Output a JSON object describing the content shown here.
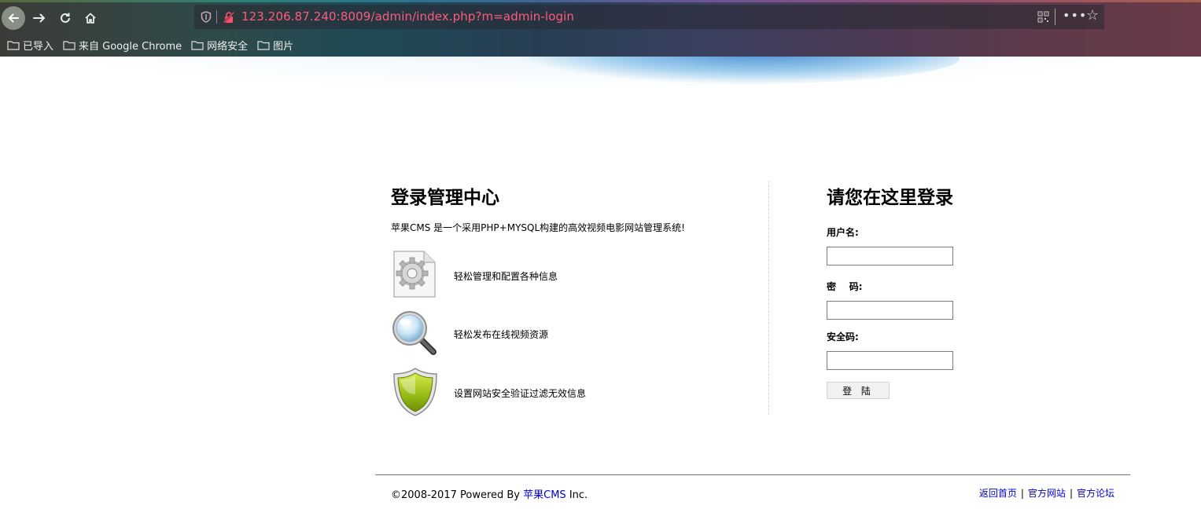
{
  "browser": {
    "url": "123.206.87.240:8009/admin/index.php?m=admin-login",
    "bookmarks": [
      "已导入",
      "来自 Google Chrome",
      "网络安全",
      "图片"
    ]
  },
  "left": {
    "title": "登录管理中心",
    "description": "苹果CMS 是一个采用PHP+MYSQL构建的高效视频电影网站管理系统!",
    "features": [
      {
        "icon": "gear-document-icon",
        "text": "轻松管理和配置各种信息"
      },
      {
        "icon": "magnifier-icon",
        "text": "轻松发布在线视频资源"
      },
      {
        "icon": "shield-icon",
        "text": "设置网站安全验证过滤无效信息"
      }
    ]
  },
  "login": {
    "title": "请您在这里登录",
    "username_label": "用户名:",
    "username_value": "",
    "password_label": "密    码:",
    "password_value": "",
    "captcha_label": "安全码:",
    "captcha_value": "",
    "submit_label": "登 陆"
  },
  "footer": {
    "copyright_prefix": "©2008-2017 Powered By ",
    "brand_link": "苹果CMS",
    "copyright_suffix": " Inc.",
    "links": [
      "返回首页",
      "官方网站",
      "官方论坛"
    ],
    "separator": "|"
  },
  "colors": {
    "url_text": "#ff5c7c",
    "link": "#0000cc"
  }
}
